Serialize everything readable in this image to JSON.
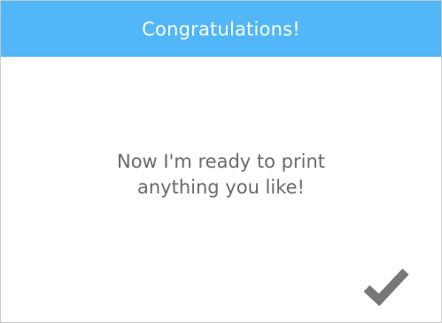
{
  "header": {
    "title": "Congratulations!",
    "color": "#51b7f8"
  },
  "message": {
    "lines": [
      "Now I'm ready to print",
      "anything you like!"
    ],
    "color": "#6a6a6a"
  },
  "actions": {
    "confirm_icon": "checkmark-icon",
    "confirm_color": "#777777"
  }
}
